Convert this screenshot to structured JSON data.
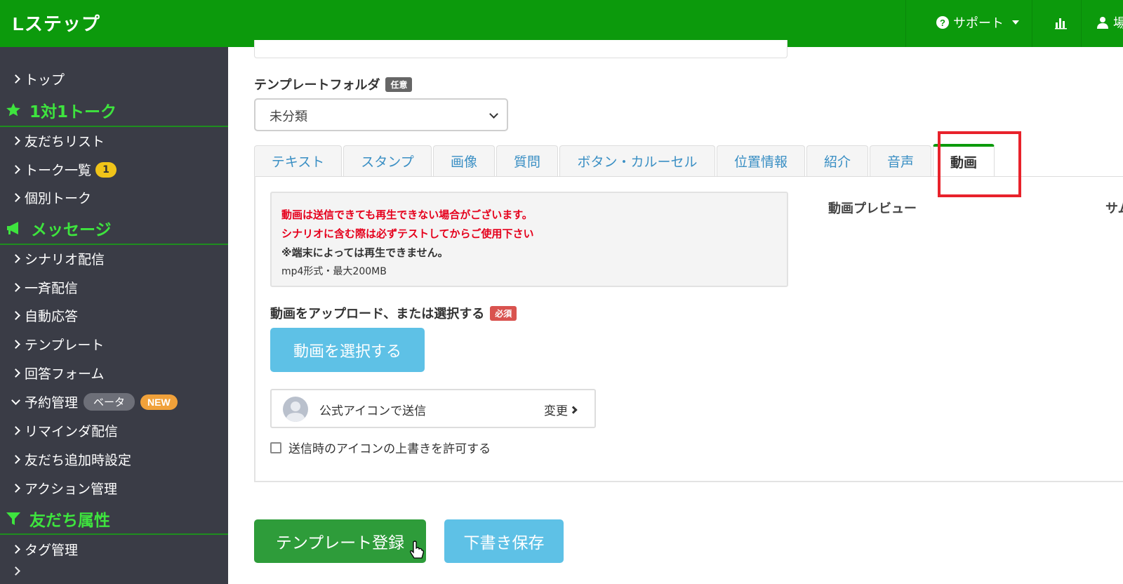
{
  "header": {
    "logo": "Lステップ",
    "support_label": "サポート",
    "user_label": "場"
  },
  "sidebar": {
    "top": "トップ",
    "section_talk": "1対1トーク",
    "friends_list": "友だちリスト",
    "talk_list": "トーク一覧",
    "talk_list_count": "1",
    "individual_talk": "個別トーク",
    "section_message": "メッセージ",
    "scenario": "シナリオ配信",
    "broadcast": "一斉配信",
    "auto_reply": "自動応答",
    "template": "テンプレート",
    "answer_form": "回答フォーム",
    "reservation": "予約管理",
    "beta_badge": "ベータ",
    "new_badge": "NEW",
    "reminder": "リマインダ配信",
    "friend_add_setting": "友だち追加時設定",
    "action_manage": "アクション管理",
    "section_attr": "友だち属性",
    "tag_manage": "タグ管理"
  },
  "main": {
    "folder_label": "テンプレートフォルダ",
    "optional_tag": "任意",
    "folder_value": "未分類",
    "tabs": [
      {
        "label": "テキスト"
      },
      {
        "label": "スタンプ"
      },
      {
        "label": "画像"
      },
      {
        "label": "質問"
      },
      {
        "label": "ボタン・カルーセル"
      },
      {
        "label": "位置情報"
      },
      {
        "label": "紹介"
      },
      {
        "label": "音声"
      },
      {
        "label": "動画"
      }
    ],
    "active_tab": "動画",
    "notice": {
      "line1": "動画は送信できても再生できない場合がございます。",
      "line2": "シナリオに含む際は必ずテストしてからご使用下さい",
      "line3": "※端末によっては再生できません。",
      "line4": "mp4形式・最大200MB"
    },
    "preview_label": "動画プレビュー",
    "side_label": "サム",
    "upload_label": "動画をアップロード、または選択する",
    "required_tag": "必須",
    "select_button": "動画を選択する",
    "icon_send": "公式アイコンで送信",
    "change": "変更",
    "allow_override": "送信時のアイコンの上書きを許可する",
    "register_button": "テンプレート登録",
    "draft_button": "下書き保存"
  },
  "colors": {
    "header_green": "#0c9a0c",
    "sidebar_bg": "#3a3c46",
    "accent_green": "#3ee43e",
    "button_blue": "#5ec1e6",
    "highlight_red": "#e8222b"
  }
}
